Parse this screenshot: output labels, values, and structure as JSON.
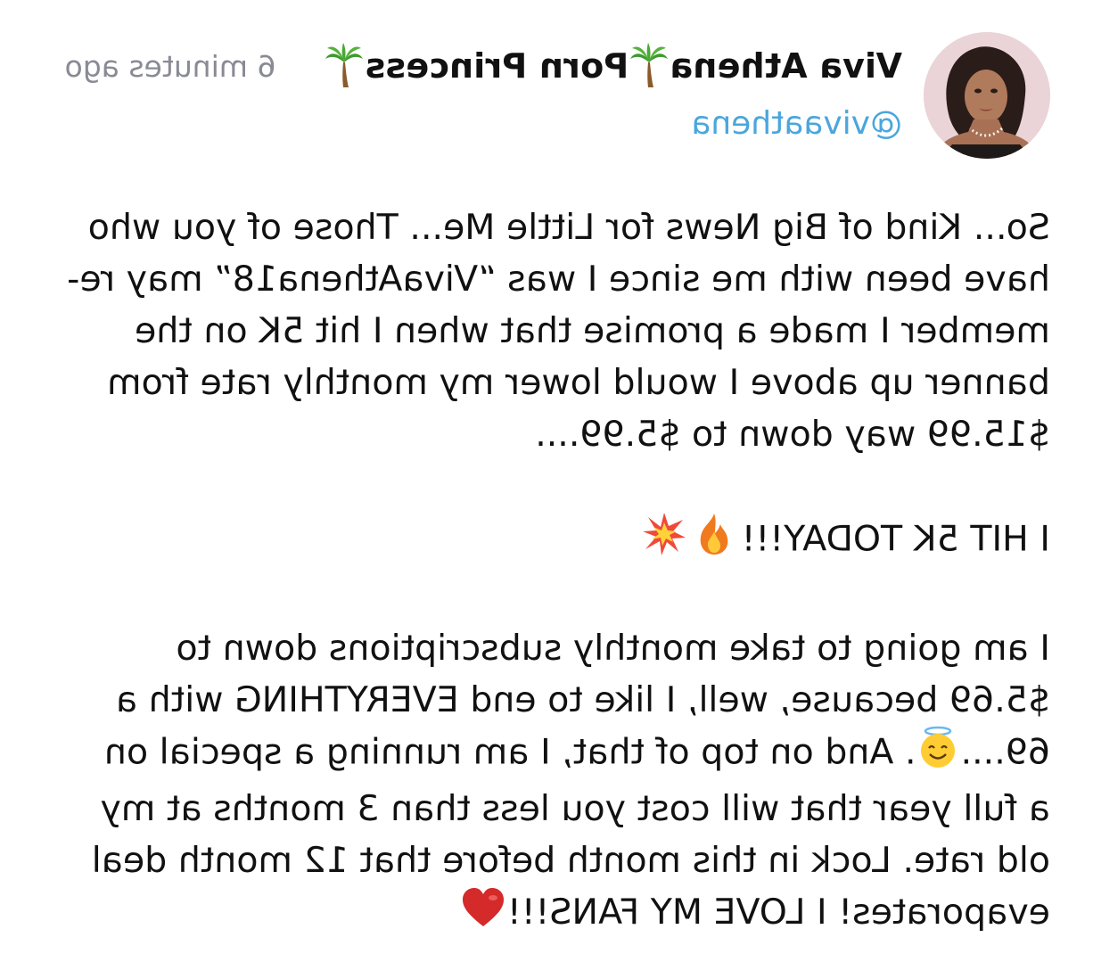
{
  "post": {
    "author": {
      "display_name_parts": [
        "Viva Athena",
        "Porn Princess"
      ],
      "name_icons": [
        "palm-tree-icon",
        "palm-tree-icon"
      ],
      "handle": "@vivaathena",
      "avatar_icon": "profile-photo"
    },
    "timestamp": "6 minutes ago",
    "paragraphs": [
      {
        "lines": [
          "So... Kind of Big News for Little Me... Those of you who",
          "have been with me since I was “VivaAthena18” may re-",
          "member I made a promise that when I hit 5K on the",
          "banner up above I would lower my monthly rate from",
          "$15.99 way down to $5.99...."
        ]
      },
      {
        "lines": [
          "I HIT 5K TODAY!!!"
        ],
        "trailing_icons": [
          "fire-icon",
          "collision-icon"
        ]
      },
      {
        "lines": [
          "I am going to take monthly subscriptions down to",
          "$5.69 because, well, I like to end EVERYTHING with a",
          "69....",
          "a full year that will cost you less than 3 months at my",
          "old rate. Lock in this month before that 12 month deal",
          "evaporates! I LOVE MY FANS!!!"
        ],
        "line3_after_icon": ". And on top of that, I am running a special on",
        "inline_icons": [
          "smiling-halo-icon",
          "red-heart-icon"
        ]
      }
    ],
    "colors": {
      "text": "#111111",
      "handle": "#4aa6dd",
      "timestamp": "#8a8a95",
      "background": "#ffffff"
    }
  }
}
